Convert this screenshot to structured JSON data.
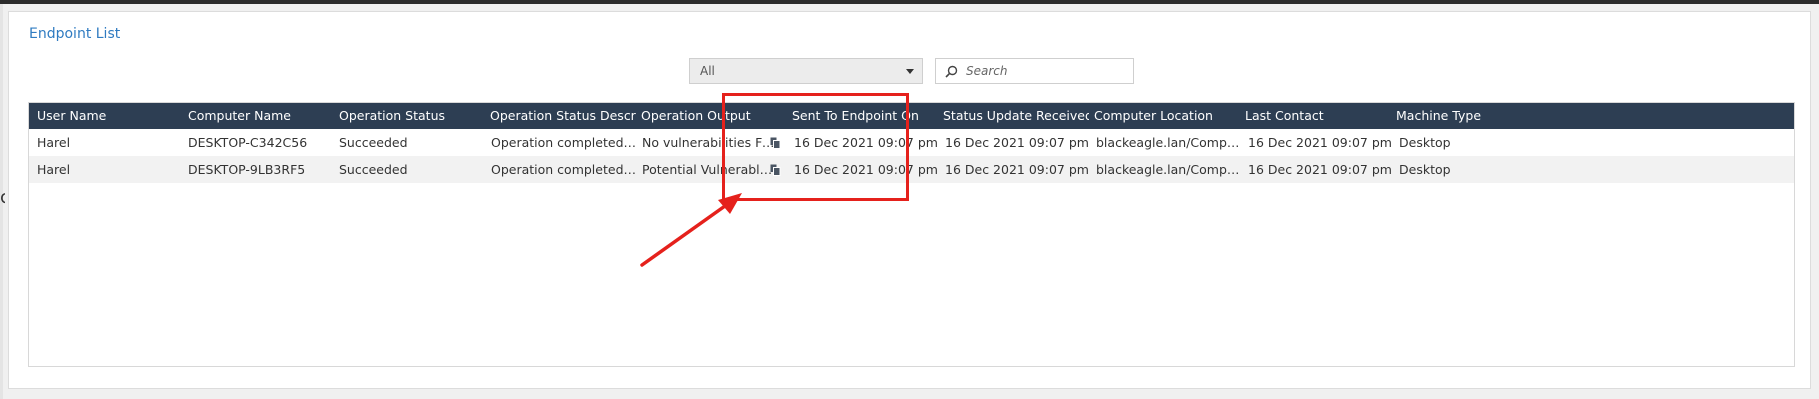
{
  "panel": {
    "title": "Endpoint List"
  },
  "filter": {
    "selected": "All"
  },
  "search": {
    "placeholder": "Search"
  },
  "table": {
    "columns": [
      "User Name",
      "Computer Name",
      "Operation Status",
      "Operation Status Description",
      "Operation Output",
      "Sent To Endpoint On",
      "Status Update Received On",
      "Computer Location",
      "Last Contact",
      "Machine Type"
    ],
    "rows": [
      [
        "Harel",
        "DESKTOP-C342C56",
        "Succeeded",
        "Operation completed success...",
        "No vulnerabilities Found",
        "16 Dec 2021 09:07 pm",
        "16 Dec 2021 09:07 pm",
        "blackeagle.lan/Computers/D...",
        "16 Dec 2021 09:07 pm",
        "Desktop"
      ],
      [
        "Harel",
        "DESKTOP-9LB3RF5",
        "Succeeded",
        "Operation completed success...",
        "Potential Vulnerable Fil...",
        "16 Dec 2021 09:07 pm",
        "16 Dec 2021 09:07 pm",
        "blackeagle.lan/Computers/D...",
        "16 Dec 2021 09:07 pm",
        "Desktop"
      ]
    ]
  },
  "colors": {
    "header_bg": "#2d3e53",
    "title_blue": "#2f7bc1",
    "annotation_red": "#e5211c"
  },
  "icons": {
    "copy": "copy-icon",
    "search": "search-icon"
  }
}
